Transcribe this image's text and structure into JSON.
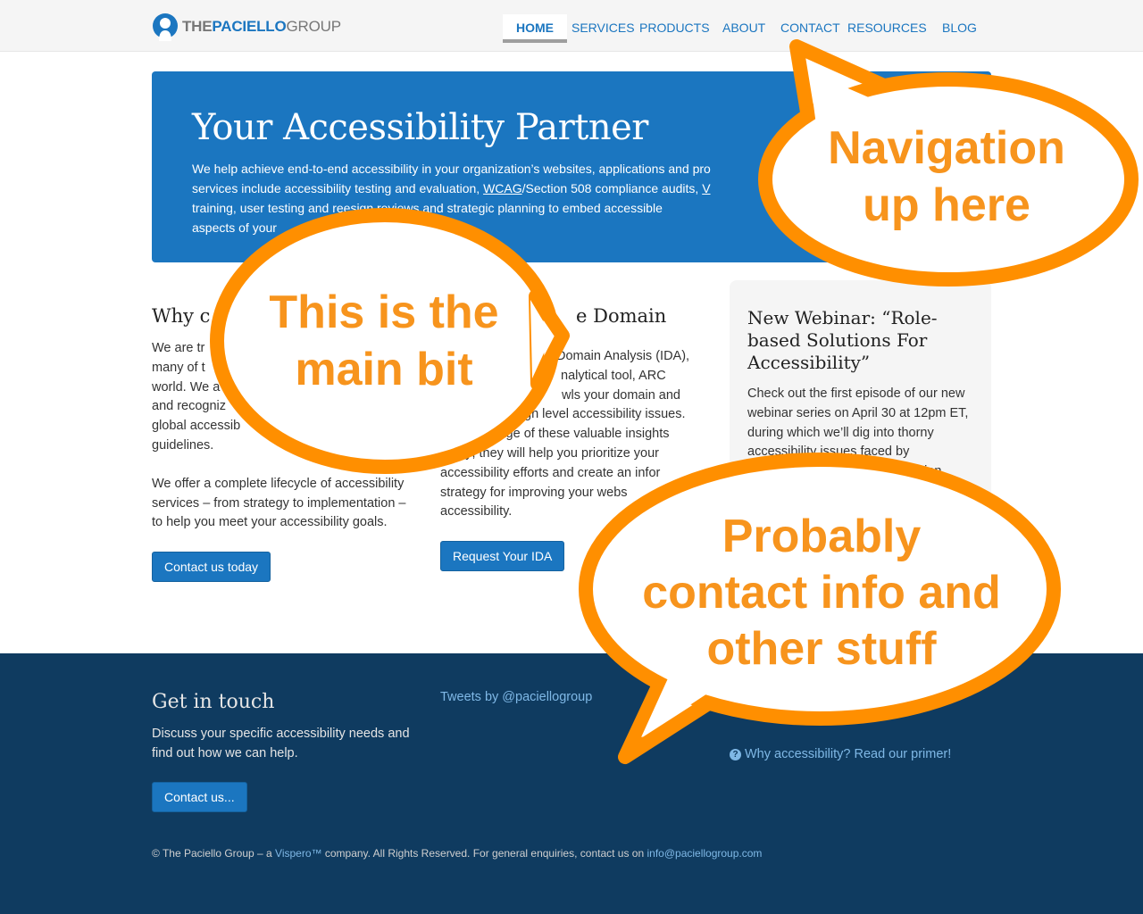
{
  "logo": {
    "the": "THE",
    "paciello": "PACIELLO",
    "group": "GROUP"
  },
  "nav": [
    {
      "label": "HOME"
    },
    {
      "label": "SERVICES"
    },
    {
      "label": "PRODUCTS"
    },
    {
      "label": "ABOUT"
    },
    {
      "label": "CONTACT"
    },
    {
      "label": "RESOURCES"
    },
    {
      "label": "BLOG"
    }
  ],
  "hero": {
    "title": "Your Accessibility Partner",
    "text_before_wcag": "We help achieve end-to-end accessibility in your organization’s websites, applications and pro",
    "line2_start": "services include accessibility testing and evaluation, ",
    "wcag": "WCAG",
    "line2_rest": "/Section 508 compliance audits, ",
    "v_link": "V",
    "line3": "training, user testing and re",
    "line3_b": "esign reviews and strategic planning to embed accessible",
    "line4": "aspects of your"
  },
  "col1": {
    "heading": "Why c",
    "p1_lines": [
      "We are tr",
      "many of t",
      "world. We a",
      "and recogniz",
      "global accessib",
      "guidelines."
    ],
    "p2": "We offer a complete lifecycle of accessibility services – from strategy to implementation – to help you meet your accessibility goals.",
    "button": "Contact us today"
  },
  "col2": {
    "heading": "e Domain",
    "p_lines": [
      "Domain Analysis (IDA),",
      "nalytical tool, ARC",
      "wls your domain and",
      "gh level accessibility issues.",
      "dvantage of these valuable insights",
      "today; they will help you prioritize your",
      "accessibility efforts and create an infor",
      "strategy for improving your webs",
      "accessibility."
    ],
    "button": "Request Your IDA"
  },
  "sidebar": {
    "heading": "New Webinar: “Role-based Solutions For Accessibility”",
    "text": "Check out the first episode of our new webinar series on April 30 at 12pm ET, during which we’ll dig into thorny accessibility issues faced by",
    "text_tail": "ation."
  },
  "footer": {
    "heading": "Get in touch",
    "text": "Discuss your specific accessibility needs and find out how we can help.",
    "button": "Contact us...",
    "tweets": "Tweets by @paciellogroup",
    "primer_icon": "?",
    "primer": "Why accessibility? Read our primer!",
    "copy_a": "© The Paciello Group – a ",
    "copy_vispero": "Vispero™",
    "copy_b": " company. All Rights Reserved. For general enquiries, contact us on ",
    "copy_email": "info@paciellogroup.com"
  },
  "annotations": {
    "nav_note": [
      "Navigation",
      "up here"
    ],
    "main_note": [
      "This is the",
      "main bit"
    ],
    "footer_note": [
      "Probably",
      "contact info and",
      "other stuff"
    ]
  },
  "colors": {
    "brand_blue": "#1b76c0",
    "footer_navy": "#0f3b60",
    "annotation_orange": "#f7941d"
  }
}
